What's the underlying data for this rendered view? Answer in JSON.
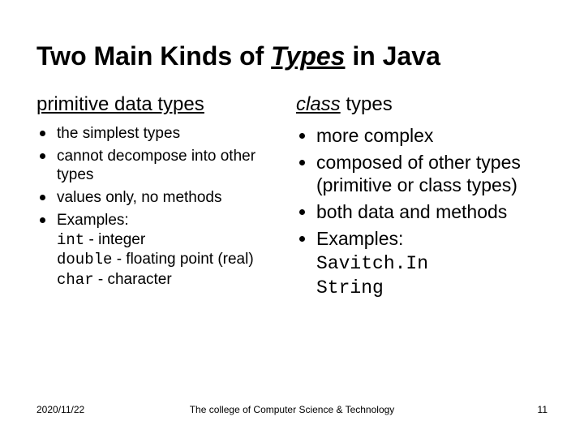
{
  "title_pre": "Two Main Kinds of ",
  "title_italic": "Types",
  "title_post": " in Java",
  "left": {
    "heading_underline": "primitive",
    "heading_rest": " data types",
    "item1": "the simplest types",
    "item2": "cannot decompose into other types",
    "item3": "values only, no methods",
    "item4_label": "Examples:",
    "item4_code1": "int",
    "item4_desc1": " - integer",
    "item4_code2": "double",
    "item4_desc2": " - floating point (real)",
    "item4_code3": "char",
    "item4_desc3": " - character"
  },
  "right": {
    "heading_italic": "class",
    "heading_rest": " types",
    "item1": "more complex",
    "item2": "composed of other types (primitive or class types)",
    "item3": "both data and methods",
    "item4_label": "Examples:",
    "item4_code1": "Savitch.In",
    "item4_code2": "String"
  },
  "footer": {
    "date": "2020/11/22",
    "center": "The college of Computer Science & Technology",
    "page": "11"
  }
}
